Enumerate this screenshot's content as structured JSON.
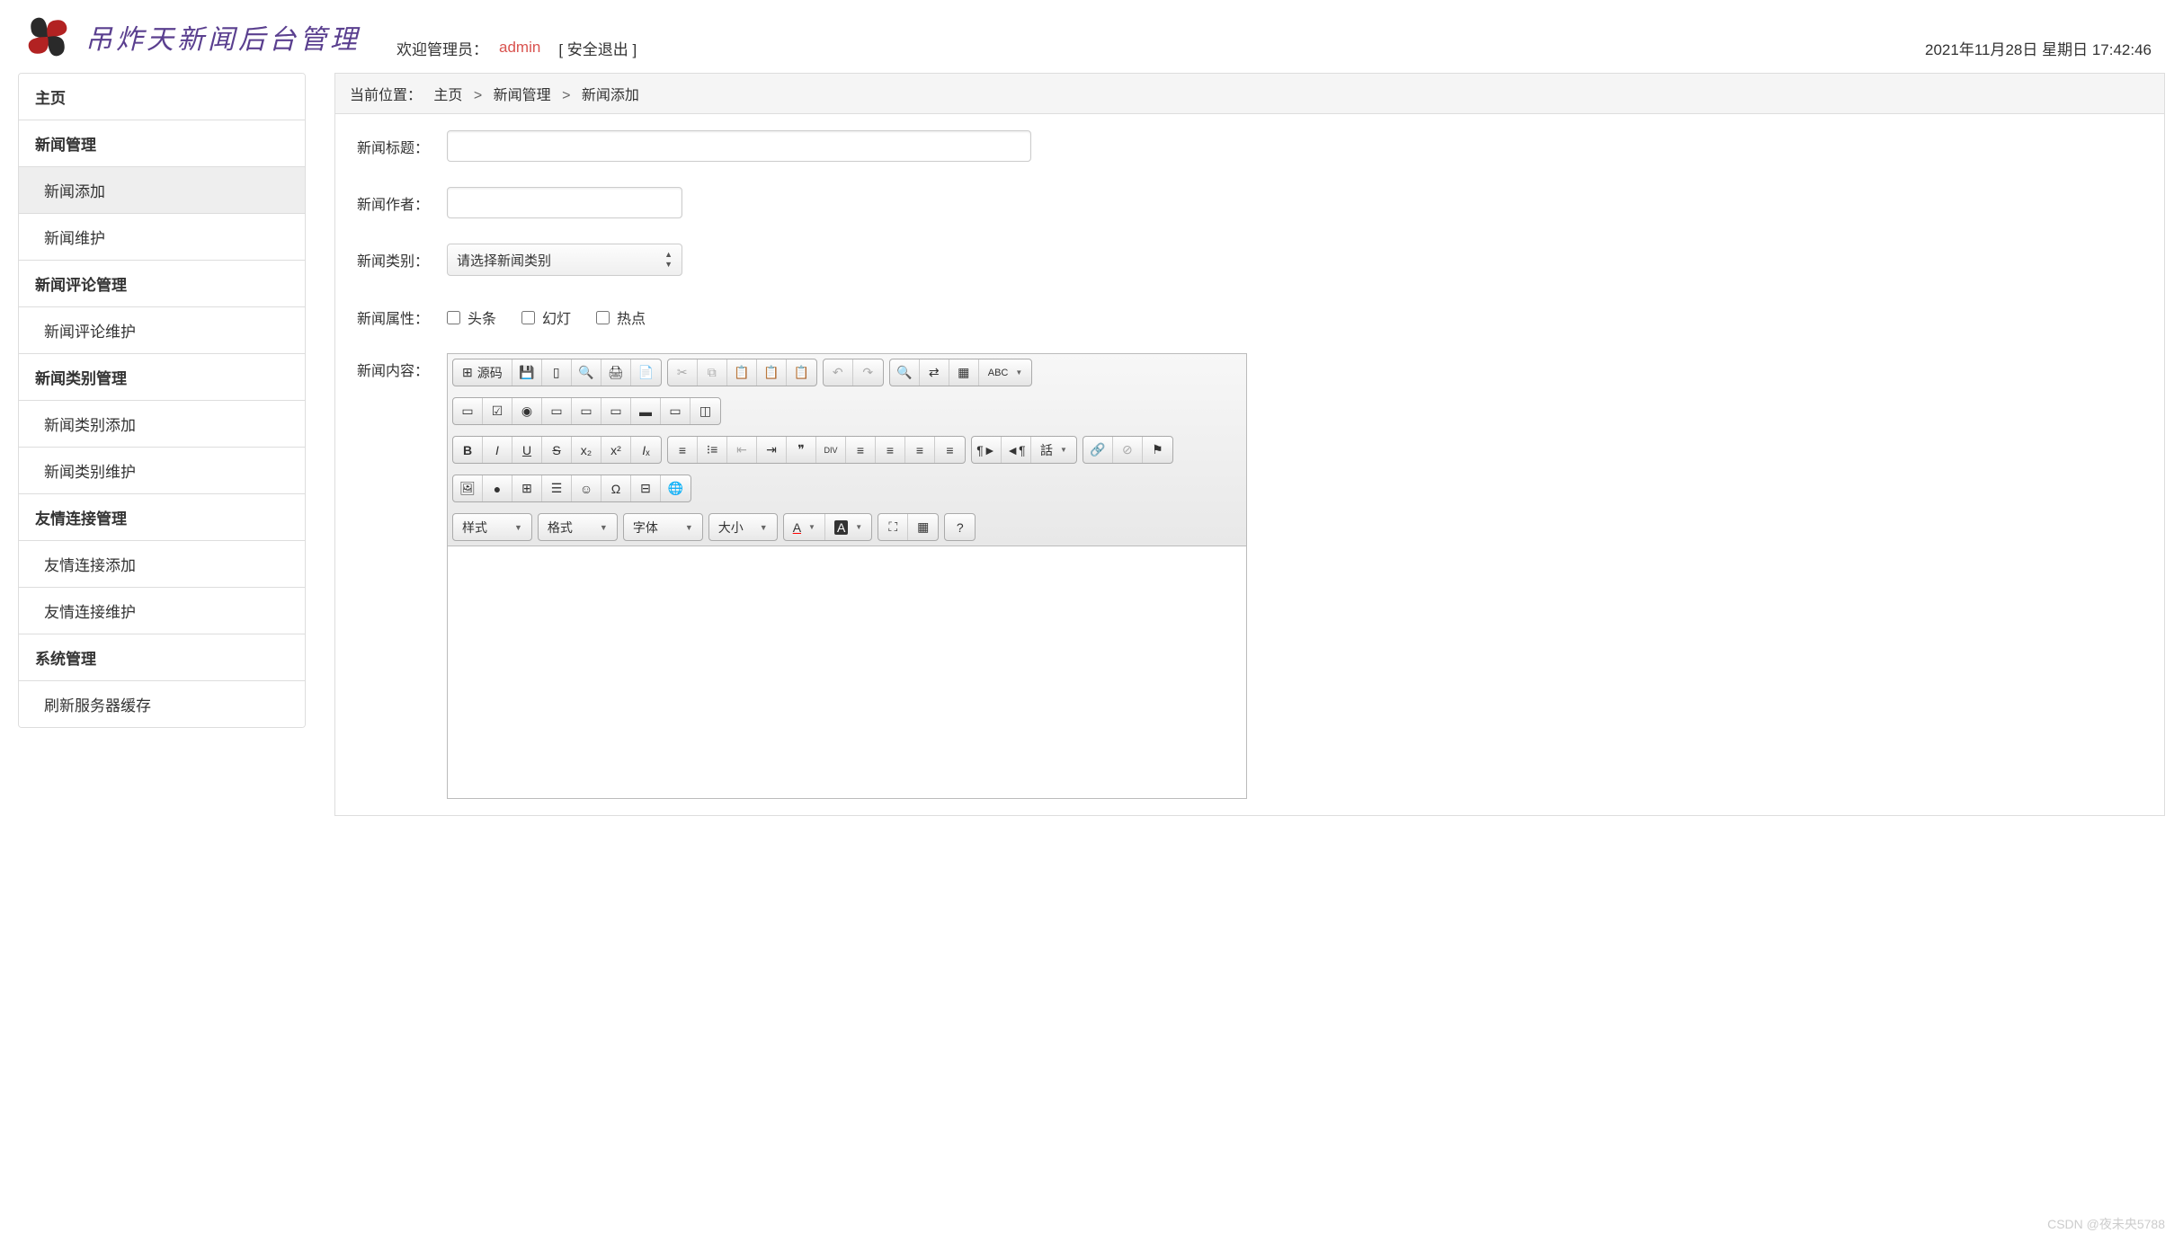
{
  "brand": "吊炸天新闻后台管理",
  "header": {
    "welcome_prefix": "欢迎管理员：",
    "admin_name": "admin",
    "logout_label": "[ 安全退出 ]"
  },
  "datetime": "2021年11月28日 星期日 17:42:46",
  "sidebar": [
    {
      "label": "主页",
      "type": "header"
    },
    {
      "label": "新闻管理",
      "type": "header"
    },
    {
      "label": "新闻添加",
      "type": "sub",
      "active": true
    },
    {
      "label": "新闻维护",
      "type": "sub"
    },
    {
      "label": "新闻评论管理",
      "type": "header"
    },
    {
      "label": "新闻评论维护",
      "type": "sub"
    },
    {
      "label": "新闻类别管理",
      "type": "header"
    },
    {
      "label": "新闻类别添加",
      "type": "sub"
    },
    {
      "label": "新闻类别维护",
      "type": "sub"
    },
    {
      "label": "友情连接管理",
      "type": "header"
    },
    {
      "label": "友情连接添加",
      "type": "sub"
    },
    {
      "label": "友情连接维护",
      "type": "sub"
    },
    {
      "label": "系统管理",
      "type": "header"
    },
    {
      "label": "刷新服务器缓存",
      "type": "sub"
    }
  ],
  "breadcrumb": {
    "prefix": "当前位置：",
    "items": [
      "主页",
      "新闻管理",
      "新闻添加"
    ],
    "sep": ">"
  },
  "form": {
    "title_label": "新闻标题：",
    "author_label": "新闻作者：",
    "category_label": "新闻类别：",
    "category_placeholder": "请选择新闻类别",
    "attr_label": "新闻属性：",
    "attrs": [
      "头条",
      "幻灯",
      "热点"
    ],
    "content_label": "新闻内容："
  },
  "editor": {
    "source_label": "源码",
    "abc_label": "ABC",
    "combos": {
      "style": "样式",
      "format": "格式",
      "font": "字体",
      "size": "大小",
      "lang": "話"
    }
  },
  "watermark": "CSDN @夜未央5788"
}
